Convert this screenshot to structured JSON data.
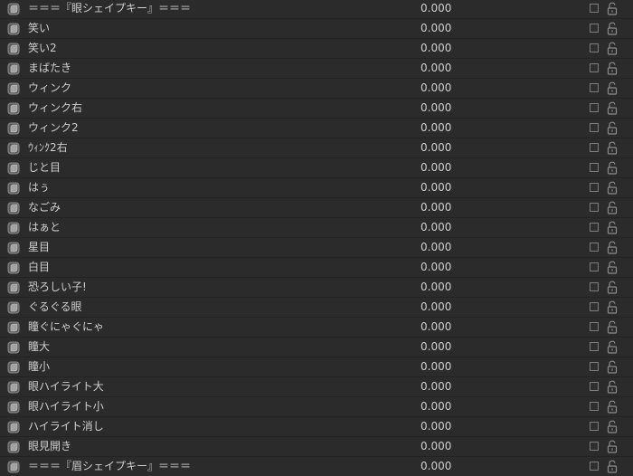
{
  "colors": {
    "background": "#2b2b2b",
    "text": "#cfcfcf",
    "row_divider": "#232323",
    "icon": "#8c8c8c"
  },
  "icons": {
    "shape": "shape-key-icon",
    "lock": "unlocked-padlock-icon"
  },
  "rows": [
    {
      "name": "＝＝＝『眼シェイプキー』＝＝＝",
      "value": "0.000"
    },
    {
      "name": "笑い",
      "value": "0.000"
    },
    {
      "name": "笑い2",
      "value": "0.000"
    },
    {
      "name": "まばたき",
      "value": "0.000"
    },
    {
      "name": "ウィンク",
      "value": "0.000"
    },
    {
      "name": "ウィンク右",
      "value": "0.000"
    },
    {
      "name": "ウィンク2",
      "value": "0.000"
    },
    {
      "name": "ｳｨﾝｸ2右",
      "value": "0.000"
    },
    {
      "name": "じと目",
      "value": "0.000"
    },
    {
      "name": "はぅ",
      "value": "0.000"
    },
    {
      "name": "なごみ",
      "value": "0.000"
    },
    {
      "name": "はぁと",
      "value": "0.000"
    },
    {
      "name": "星目",
      "value": "0.000"
    },
    {
      "name": "白目",
      "value": "0.000"
    },
    {
      "name": "恐ろしい子!",
      "value": "0.000"
    },
    {
      "name": "ぐるぐる眼",
      "value": "0.000"
    },
    {
      "name": "瞳ぐにゃぐにゃ",
      "value": "0.000"
    },
    {
      "name": "瞳大",
      "value": "0.000"
    },
    {
      "name": "瞳小",
      "value": "0.000"
    },
    {
      "name": "眼ハイライト大",
      "value": "0.000"
    },
    {
      "name": "眼ハイライト小",
      "value": "0.000"
    },
    {
      "name": "ハイライト消し",
      "value": "0.000"
    },
    {
      "name": "眼見開き",
      "value": "0.000"
    },
    {
      "name": "＝＝＝『眉シェイプキー』＝＝＝",
      "value": "0.000"
    }
  ]
}
